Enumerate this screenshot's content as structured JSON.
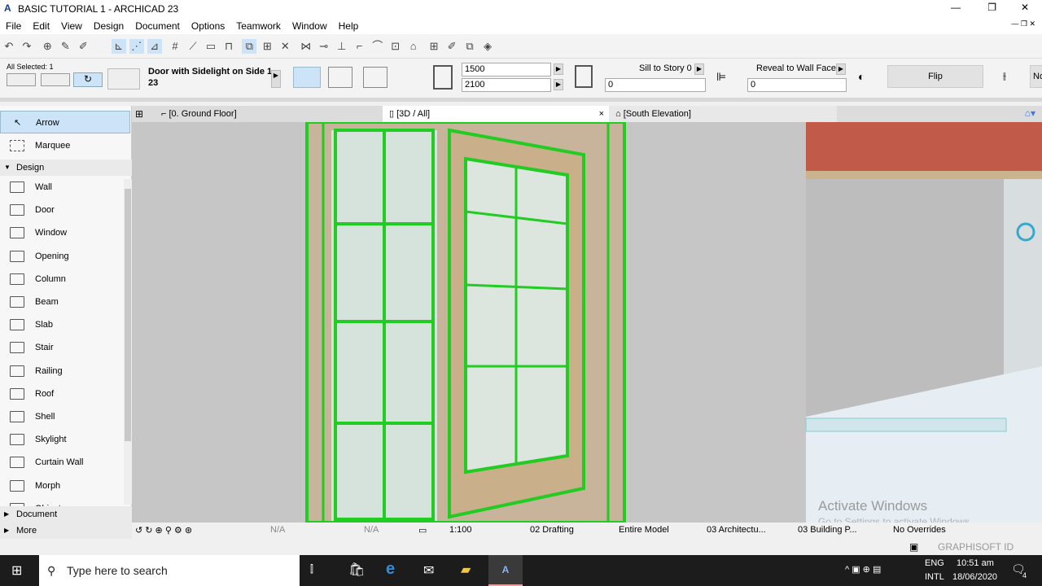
{
  "window": {
    "title": "BASIC TUTORIAL 1 - ARCHICAD 23"
  },
  "menu": [
    "File",
    "Edit",
    "View",
    "Design",
    "Document",
    "Options",
    "Teamwork",
    "Window",
    "Help"
  ],
  "infobox": {
    "selection": "All Selected: 1",
    "door_name": "Door with Sidelight on Side 1",
    "door_sub": "23",
    "width": "1500",
    "height": "2100",
    "sill_label": "Sill to Story 0",
    "sill_value": "0",
    "reveal_label": "Reveal to Wall Face",
    "reveal_value": "0",
    "flip_label": "Flip",
    "cut_label": "No"
  },
  "tabs": [
    {
      "label": "[0. Ground Floor]"
    },
    {
      "label": "[3D / All]"
    },
    {
      "label": "[South Elevation]"
    }
  ],
  "sidebar": {
    "arrow": "Arrow",
    "marquee": "Marquee",
    "design": "Design",
    "items": [
      "Wall",
      "Door",
      "Window",
      "Opening",
      "Column",
      "Beam",
      "Slab",
      "Stair",
      "Railing",
      "Roof",
      "Shell",
      "Skylight",
      "Curtain Wall",
      "Morph",
      "Object"
    ],
    "document": "Document",
    "more": "More"
  },
  "status": {
    "na1": "N/A",
    "na2": "N/A",
    "scale": "1:100",
    "layer": "02 Drafting",
    "model": "Entire Model",
    "pen": "03 Architectu...",
    "mvo": "03 Building P...",
    "overrides": "No Overrides"
  },
  "bottom": {
    "graphisoft": "GRAPHISOFT ID"
  },
  "watermark": {
    "line1": "Activate Windows",
    "line2": "Go to Settings to activate Windows."
  },
  "taskbar": {
    "search": "Type here to search",
    "lang1": "ENG",
    "lang2": "INTL",
    "time": "10:51 am",
    "date": "18/06/2020",
    "notif": "4"
  },
  "colors": {
    "selection": "#22cc22",
    "accent": "#cde3f7"
  }
}
